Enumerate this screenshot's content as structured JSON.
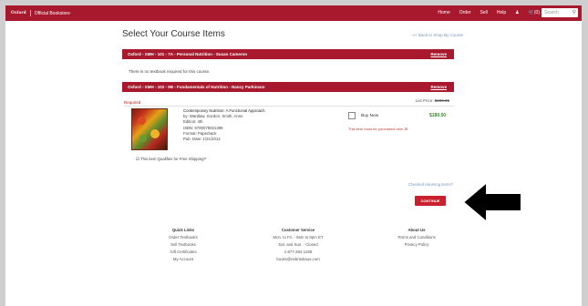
{
  "header": {
    "logo": "Oxford",
    "subtitle": "Official Bookstore",
    "nav": [
      "Home",
      "Order",
      "Sell",
      "Help"
    ],
    "cart": "(0)",
    "search_placeholder": "Search"
  },
  "page": {
    "title": "Select Your Course Items",
    "back_link": "<< Back to Shop By Course"
  },
  "courses": [
    {
      "name": "Oxford - XMH - 101 - 7A - Personal Nutrition - Susan Cameron",
      "remove": "Remove",
      "note": "There is no textbook required for this course."
    },
    {
      "name": "Oxford - XMH - 102 - 9B - Fundamentals of Nutrition - Nancy Parkinson",
      "remove": "Remove"
    }
  ],
  "book": {
    "required": "Required",
    "list_price_label": "List Price:",
    "list_price": "$189.95",
    "title": "Contemporary Nutrition: A Functional Approach",
    "authors": "by: Wardlaw, Gordon; Smith, Anne",
    "edition": "Edition: 4th",
    "isbn": "ISBN: 9780078021398",
    "format": "Format: Paperback",
    "pub_date": "Pub. Date: 1/21/2014",
    "buy_label": "Buy New",
    "price": "$180.50",
    "return_note": "This item must be purchased new. ☒",
    "free_shipping": "This item Qualifies for Free Shipping!*"
  },
  "actions": {
    "textbook_question": "Checked returning items?",
    "continue": "CONTINUE"
  },
  "footer": {
    "columns": [
      {
        "heading": "Quick Links",
        "items": [
          "Order Textbooks",
          "Sell Textbooks",
          "Gift Certificates",
          "My Account"
        ]
      },
      {
        "heading": "Customer Service",
        "items": [
          "Mon. to Fri. - 9am to 8pm ET",
          "Sat. and Sun. - Closed",
          "1-877-284-1266",
          "books@nebraskaus.com"
        ]
      },
      {
        "heading": "About Us",
        "items": [
          "Terms and Conditions",
          "Privacy Policy"
        ]
      }
    ]
  }
}
